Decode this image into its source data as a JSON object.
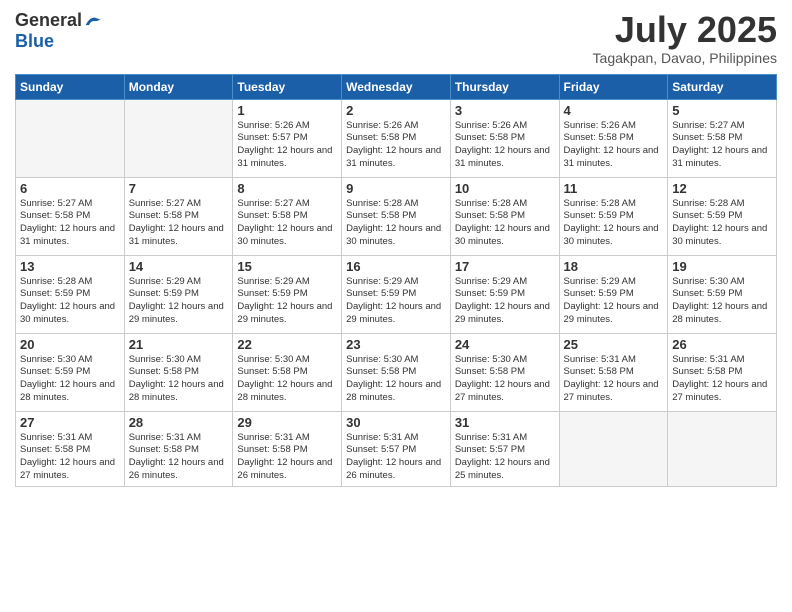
{
  "logo": {
    "general": "General",
    "blue": "Blue"
  },
  "header": {
    "month": "July 2025",
    "location": "Tagakpan, Davao, Philippines"
  },
  "weekdays": [
    "Sunday",
    "Monday",
    "Tuesday",
    "Wednesday",
    "Thursday",
    "Friday",
    "Saturday"
  ],
  "weeks": [
    [
      {
        "day": "",
        "sunrise": "",
        "sunset": "",
        "daylight": ""
      },
      {
        "day": "",
        "sunrise": "",
        "sunset": "",
        "daylight": ""
      },
      {
        "day": "1",
        "sunrise": "Sunrise: 5:26 AM",
        "sunset": "Sunset: 5:57 PM",
        "daylight": "Daylight: 12 hours and 31 minutes."
      },
      {
        "day": "2",
        "sunrise": "Sunrise: 5:26 AM",
        "sunset": "Sunset: 5:58 PM",
        "daylight": "Daylight: 12 hours and 31 minutes."
      },
      {
        "day": "3",
        "sunrise": "Sunrise: 5:26 AM",
        "sunset": "Sunset: 5:58 PM",
        "daylight": "Daylight: 12 hours and 31 minutes."
      },
      {
        "day": "4",
        "sunrise": "Sunrise: 5:26 AM",
        "sunset": "Sunset: 5:58 PM",
        "daylight": "Daylight: 12 hours and 31 minutes."
      },
      {
        "day": "5",
        "sunrise": "Sunrise: 5:27 AM",
        "sunset": "Sunset: 5:58 PM",
        "daylight": "Daylight: 12 hours and 31 minutes."
      }
    ],
    [
      {
        "day": "6",
        "sunrise": "Sunrise: 5:27 AM",
        "sunset": "Sunset: 5:58 PM",
        "daylight": "Daylight: 12 hours and 31 minutes."
      },
      {
        "day": "7",
        "sunrise": "Sunrise: 5:27 AM",
        "sunset": "Sunset: 5:58 PM",
        "daylight": "Daylight: 12 hours and 31 minutes."
      },
      {
        "day": "8",
        "sunrise": "Sunrise: 5:27 AM",
        "sunset": "Sunset: 5:58 PM",
        "daylight": "Daylight: 12 hours and 30 minutes."
      },
      {
        "day": "9",
        "sunrise": "Sunrise: 5:28 AM",
        "sunset": "Sunset: 5:58 PM",
        "daylight": "Daylight: 12 hours and 30 minutes."
      },
      {
        "day": "10",
        "sunrise": "Sunrise: 5:28 AM",
        "sunset": "Sunset: 5:58 PM",
        "daylight": "Daylight: 12 hours and 30 minutes."
      },
      {
        "day": "11",
        "sunrise": "Sunrise: 5:28 AM",
        "sunset": "Sunset: 5:59 PM",
        "daylight": "Daylight: 12 hours and 30 minutes."
      },
      {
        "day": "12",
        "sunrise": "Sunrise: 5:28 AM",
        "sunset": "Sunset: 5:59 PM",
        "daylight": "Daylight: 12 hours and 30 minutes."
      }
    ],
    [
      {
        "day": "13",
        "sunrise": "Sunrise: 5:28 AM",
        "sunset": "Sunset: 5:59 PM",
        "daylight": "Daylight: 12 hours and 30 minutes."
      },
      {
        "day": "14",
        "sunrise": "Sunrise: 5:29 AM",
        "sunset": "Sunset: 5:59 PM",
        "daylight": "Daylight: 12 hours and 29 minutes."
      },
      {
        "day": "15",
        "sunrise": "Sunrise: 5:29 AM",
        "sunset": "Sunset: 5:59 PM",
        "daylight": "Daylight: 12 hours and 29 minutes."
      },
      {
        "day": "16",
        "sunrise": "Sunrise: 5:29 AM",
        "sunset": "Sunset: 5:59 PM",
        "daylight": "Daylight: 12 hours and 29 minutes."
      },
      {
        "day": "17",
        "sunrise": "Sunrise: 5:29 AM",
        "sunset": "Sunset: 5:59 PM",
        "daylight": "Daylight: 12 hours and 29 minutes."
      },
      {
        "day": "18",
        "sunrise": "Sunrise: 5:29 AM",
        "sunset": "Sunset: 5:59 PM",
        "daylight": "Daylight: 12 hours and 29 minutes."
      },
      {
        "day": "19",
        "sunrise": "Sunrise: 5:30 AM",
        "sunset": "Sunset: 5:59 PM",
        "daylight": "Daylight: 12 hours and 28 minutes."
      }
    ],
    [
      {
        "day": "20",
        "sunrise": "Sunrise: 5:30 AM",
        "sunset": "Sunset: 5:59 PM",
        "daylight": "Daylight: 12 hours and 28 minutes."
      },
      {
        "day": "21",
        "sunrise": "Sunrise: 5:30 AM",
        "sunset": "Sunset: 5:58 PM",
        "daylight": "Daylight: 12 hours and 28 minutes."
      },
      {
        "day": "22",
        "sunrise": "Sunrise: 5:30 AM",
        "sunset": "Sunset: 5:58 PM",
        "daylight": "Daylight: 12 hours and 28 minutes."
      },
      {
        "day": "23",
        "sunrise": "Sunrise: 5:30 AM",
        "sunset": "Sunset: 5:58 PM",
        "daylight": "Daylight: 12 hours and 28 minutes."
      },
      {
        "day": "24",
        "sunrise": "Sunrise: 5:30 AM",
        "sunset": "Sunset: 5:58 PM",
        "daylight": "Daylight: 12 hours and 27 minutes."
      },
      {
        "day": "25",
        "sunrise": "Sunrise: 5:31 AM",
        "sunset": "Sunset: 5:58 PM",
        "daylight": "Daylight: 12 hours and 27 minutes."
      },
      {
        "day": "26",
        "sunrise": "Sunrise: 5:31 AM",
        "sunset": "Sunset: 5:58 PM",
        "daylight": "Daylight: 12 hours and 27 minutes."
      }
    ],
    [
      {
        "day": "27",
        "sunrise": "Sunrise: 5:31 AM",
        "sunset": "Sunset: 5:58 PM",
        "daylight": "Daylight: 12 hours and 27 minutes."
      },
      {
        "day": "28",
        "sunrise": "Sunrise: 5:31 AM",
        "sunset": "Sunset: 5:58 PM",
        "daylight": "Daylight: 12 hours and 26 minutes."
      },
      {
        "day": "29",
        "sunrise": "Sunrise: 5:31 AM",
        "sunset": "Sunset: 5:58 PM",
        "daylight": "Daylight: 12 hours and 26 minutes."
      },
      {
        "day": "30",
        "sunrise": "Sunrise: 5:31 AM",
        "sunset": "Sunset: 5:57 PM",
        "daylight": "Daylight: 12 hours and 26 minutes."
      },
      {
        "day": "31",
        "sunrise": "Sunrise: 5:31 AM",
        "sunset": "Sunset: 5:57 PM",
        "daylight": "Daylight: 12 hours and 25 minutes."
      },
      {
        "day": "",
        "sunrise": "",
        "sunset": "",
        "daylight": ""
      },
      {
        "day": "",
        "sunrise": "",
        "sunset": "",
        "daylight": ""
      }
    ]
  ]
}
